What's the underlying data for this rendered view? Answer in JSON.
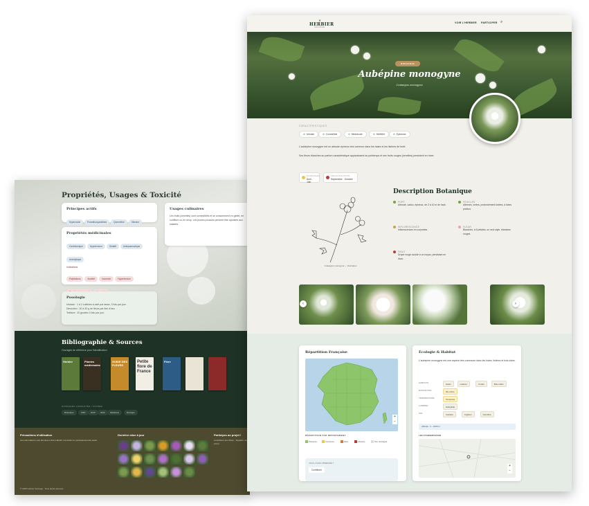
{
  "back": {
    "section_title": "Propriétés, Usages & Toxicité",
    "actifs": {
      "title": "Principes actifs",
      "items": [
        "Hyperoside",
        "Proanthocyanidines",
        "Quercétine",
        "Vitexine",
        "Rutoside"
      ]
    },
    "medicinales": {
      "title": "Propriétés médicinales",
      "items": [
        "Cardiotonique",
        "Hypotenseur",
        "Sédatif",
        "Antispasmodique",
        "Anxiolytique"
      ],
      "indications_label": "Indications",
      "indications": [
        "Palpitations",
        "Anxiété",
        "Insomnie",
        "Hypertension",
        "Troubles du sommeil",
        "Nervosité"
      ]
    },
    "posologie": {
      "title": "Posologie",
      "lines": [
        "Infusion : 1 à 2 cuillères à café par tasse, 3 fois par jour.",
        "Décoction : 20 à 30 g de fleurs par litre d'eau.",
        "Teinture : 20 gouttes 3 fois par jour."
      ]
    },
    "usages": {
      "title": "Usages culinaires",
      "text": "Les fruits (cenelles) sont comestibles et se consomment en gelée, en confiture ou en sirop. Les jeunes pousses peuvent être ajoutées aux salades."
    },
    "biblio_title": "Bibliographie & Sources",
    "biblio_sub": "Ouvrages de référence pour l'identification",
    "books": [
      "GUIDE DES FLEURS",
      "Petite flore de France",
      "Plantes médicinales",
      "Flore",
      "Herbier"
    ],
    "filter_label": "OUVRAGES CONSULTÉS / FILTRER",
    "filters": [
      "Botanique",
      "1987",
      "2015",
      "2020",
      "Médicinal",
      "Écologie"
    ],
    "footer": {
      "col1_title": "Précautions d'utilisation",
      "col1_text": "Ces informations sont données à titre indicatif. Consultez un professionnel de santé.",
      "col2_title": "Dernière mise à jour",
      "col3_title": "Participez au projet !",
      "col3_text": "Contribuez aux fiches · Signalez une erreur",
      "copyright": "© 2025 Herbier Sauvage · Tous droits réservés"
    }
  },
  "front": {
    "logo": {
      "name": "HERBIER",
      "sub": "SAUVAGE"
    },
    "nav": [
      "VOIR L'HERBIER",
      "PARTICIPER"
    ],
    "hero": {
      "badge": "ROSACEAE",
      "title": "Aubépine monogyne",
      "subtitle": "Crataegus monogyna"
    },
    "carac_label": "CARACTÉRISTIQUES",
    "tags": [
      "Arbuste",
      "Comestible",
      "Médicinale",
      "Mellifère",
      "Épineuse"
    ],
    "intro1": "L'aubépine monogyne est un arbuste épineux très commun dans les haies et les lisières de forêt.",
    "intro2": "Ses fleurs blanches au parfum caractéristique apparaissent au printemps et ses fruits rouges (cenelles) persistent en hiver.",
    "floraison": {
      "label": "FLORAISON",
      "value": "Avril - Juin"
    },
    "fructification": {
      "label": "FRUCTIFICATION",
      "value": "Septembre - Octobre"
    },
    "desc_title": "Description Botanique",
    "sketch_caption": "Crataegus monogyna — illustration",
    "desc": [
      {
        "head": "PORT",
        "text": "Arbuste, caduc, épineux, de 2 à 10 m de haut."
      },
      {
        "head": "FEUILLES",
        "text": "Alternes, vertes, profondément lobées, à lobes pointus."
      },
      {
        "head": "INFLORESCENCE",
        "text": "Inflorescences en corymbes."
      },
      {
        "head": "FLEUR",
        "text": "Blanches, à 5 pétales, un seul style, étamines rouges."
      },
      {
        "head": "FRUIT",
        "text": "Drupe rouge ovoïde à un noyau, persistant en hiver."
      }
    ],
    "repartition": {
      "title": "Répartition Française",
      "map_label": "RÉPARTITION PAR DÉPARTEMENT",
      "legend": [
        "Présence",
        "Commune",
        "Rare",
        "Absente",
        "Non renseigné"
      ],
      "contrib_label": "VOUS L'AVEZ OBSERVÉE ?",
      "contrib_btn": "Contribuer"
    },
    "ecologie": {
      "title": "Écologie & Habitat",
      "text": "L'aubépine monogyne est une espèce très commune dans les haies, lisières et bois clairs.",
      "rows": [
        {
          "label": "HABITATS",
          "pills": [
            "Haies",
            "Lisières",
            "Forêts",
            "Bois clairs"
          ]
        },
        {
          "label": "EXPOSITION",
          "pills": [
            "Mi-ombre"
          ]
        },
        {
          "label": "TEMPÉRATURE",
          "pills": [
            "Tempérée"
          ]
        },
        {
          "label": "LUMIÈRE",
          "pills": [
            "Héliophile"
          ]
        },
        {
          "label": "SOL",
          "pills": [
            "Calcaire",
            "Argileux",
            "Humifère"
          ]
        }
      ],
      "altitude": "Altitude : 0 - 1600 m",
      "obs_label": "LIEU D'OBSERVATION"
    }
  }
}
